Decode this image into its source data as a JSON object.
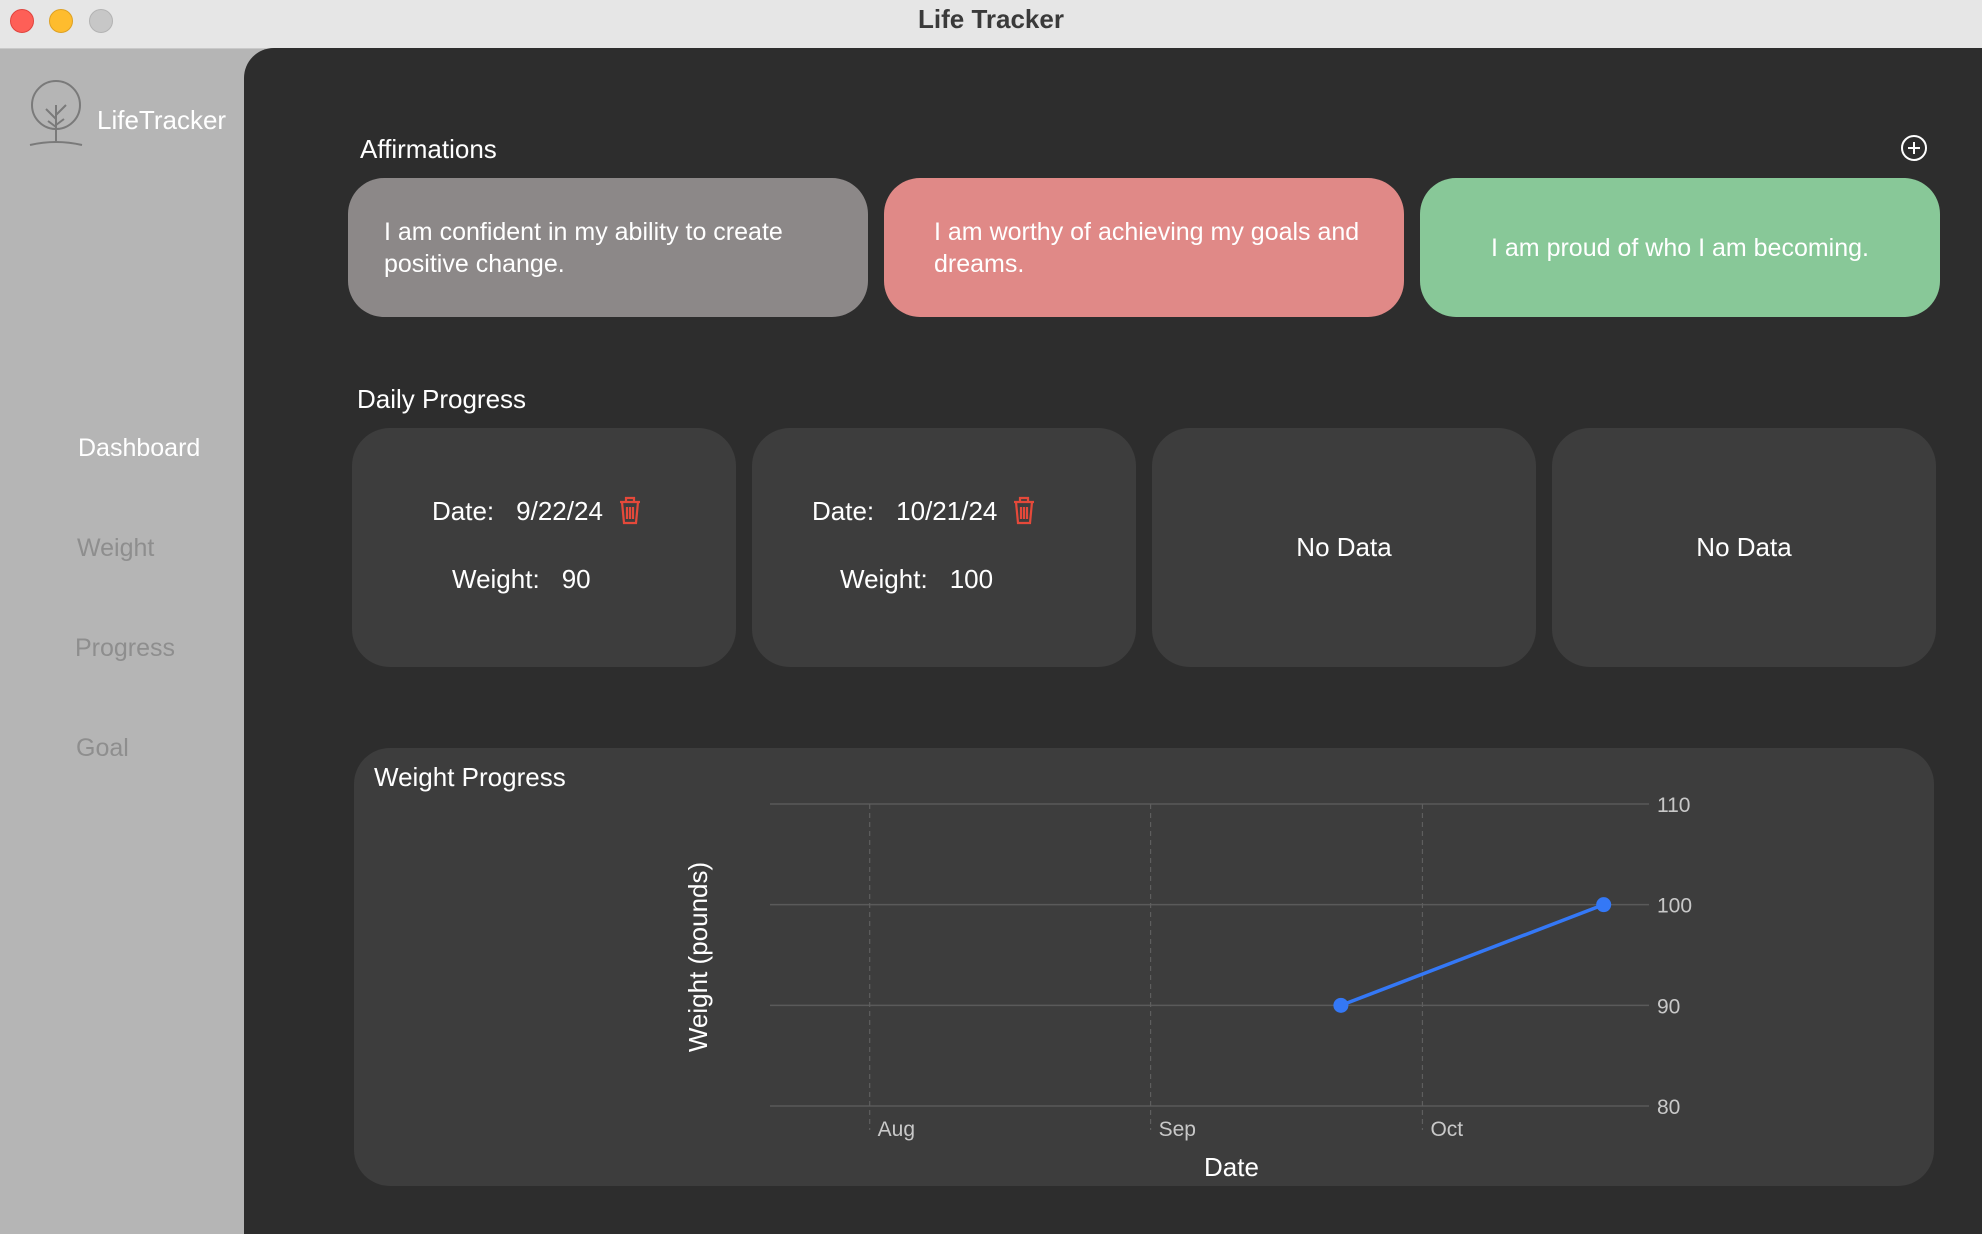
{
  "window": {
    "title": "Life Tracker"
  },
  "sidebar": {
    "brand": "LifeTracker",
    "items": [
      {
        "label": "Dashboard",
        "active": true
      },
      {
        "label": "Weight",
        "active": false
      },
      {
        "label": "Progress",
        "active": false
      },
      {
        "label": "Goal",
        "active": false
      }
    ]
  },
  "affirmations": {
    "title": "Affirmations",
    "cards": [
      {
        "text": "I am confident in my ability to create positive change.",
        "color": "#8c8888"
      },
      {
        "text": "I am worthy of achieving my goals and dreams.",
        "color": "#e08987"
      },
      {
        "text": "I am proud of who I am becoming.",
        "color": "#88c898"
      }
    ]
  },
  "daily_progress": {
    "title": "Daily Progress",
    "date_label": "Date:",
    "weight_label": "Weight:",
    "entries": [
      {
        "date": "9/22/24",
        "weight": "90"
      },
      {
        "date": "10/21/24",
        "weight": "100"
      }
    ],
    "empty_label": "No Data"
  },
  "weight_progress": {
    "title": "Weight Progress"
  },
  "colors": {
    "accent": "#3478f6",
    "trash": "#e5493a",
    "panel": "#3d3d3d",
    "main_bg": "#2d2d2d"
  },
  "chart_data": {
    "type": "line",
    "xlabel": "Date",
    "ylabel": "Weight (pounds)",
    "ylim": [
      80,
      110
    ],
    "yticks": [
      110,
      100,
      90,
      80
    ],
    "xticks": [
      "Aug",
      "Sep",
      "Oct"
    ],
    "xlim": [
      "2024-07-21",
      "2024-10-26"
    ],
    "xtick_dates": [
      "2024-08-01",
      "2024-09-01",
      "2024-10-01"
    ],
    "y_axis_position": "right",
    "grid": true,
    "series": [
      {
        "x": [
          "2024-09-22",
          "2024-10-21"
        ],
        "values": [
          90,
          100
        ]
      }
    ]
  }
}
